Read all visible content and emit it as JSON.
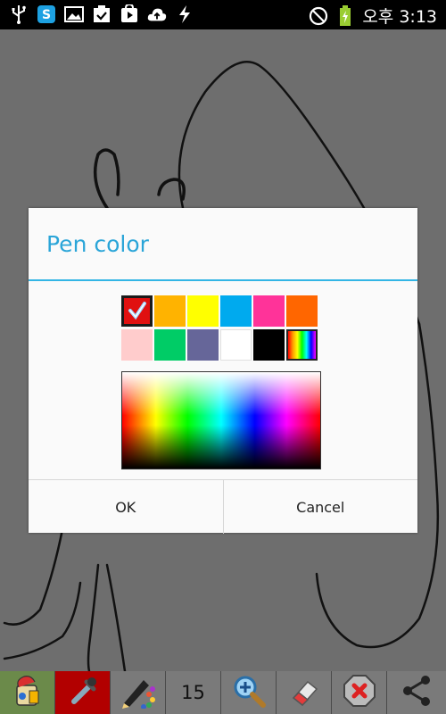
{
  "status_bar": {
    "time": "오후 3:13",
    "left_icons": [
      "usb-icon",
      "skype-icon",
      "gallery-icon",
      "download-complete-icon",
      "play-store-icon",
      "cloud-upload-icon",
      "flash-icon"
    ],
    "right_icons": [
      "no-signal-icon",
      "battery-charging-icon"
    ]
  },
  "dialog": {
    "title": "Pen color",
    "swatches": [
      {
        "color": "#e01010",
        "selected": true
      },
      {
        "color": "#ffb300",
        "selected": false
      },
      {
        "color": "#ffff00",
        "selected": false
      },
      {
        "color": "#00aaee",
        "selected": false
      },
      {
        "color": "#ff3399",
        "selected": false
      },
      {
        "color": "#ff6600",
        "selected": false
      },
      {
        "color": "#ffcccc",
        "selected": false
      },
      {
        "color": "#00cc66",
        "selected": false
      },
      {
        "color": "#666699",
        "selected": false
      },
      {
        "color": "#ffffff",
        "selected": false
      },
      {
        "color": "#000000",
        "selected": false
      },
      {
        "color": "rainbow",
        "selected": false
      }
    ],
    "ok_label": "OK",
    "cancel_label": "Cancel"
  },
  "toolbar": {
    "items": [
      "paint-bucket-icon",
      "eyedropper-icon",
      "pen-palette-icon",
      "brush-size",
      "zoom-in-icon",
      "eraser-icon",
      "clear-icon",
      "share-icon"
    ],
    "brush_size": "15"
  },
  "colors": {
    "accent": "#33b5e5",
    "title": "#2aa5d8",
    "canvas_dim": "#6e6e6e",
    "status_bar": "#000000"
  }
}
